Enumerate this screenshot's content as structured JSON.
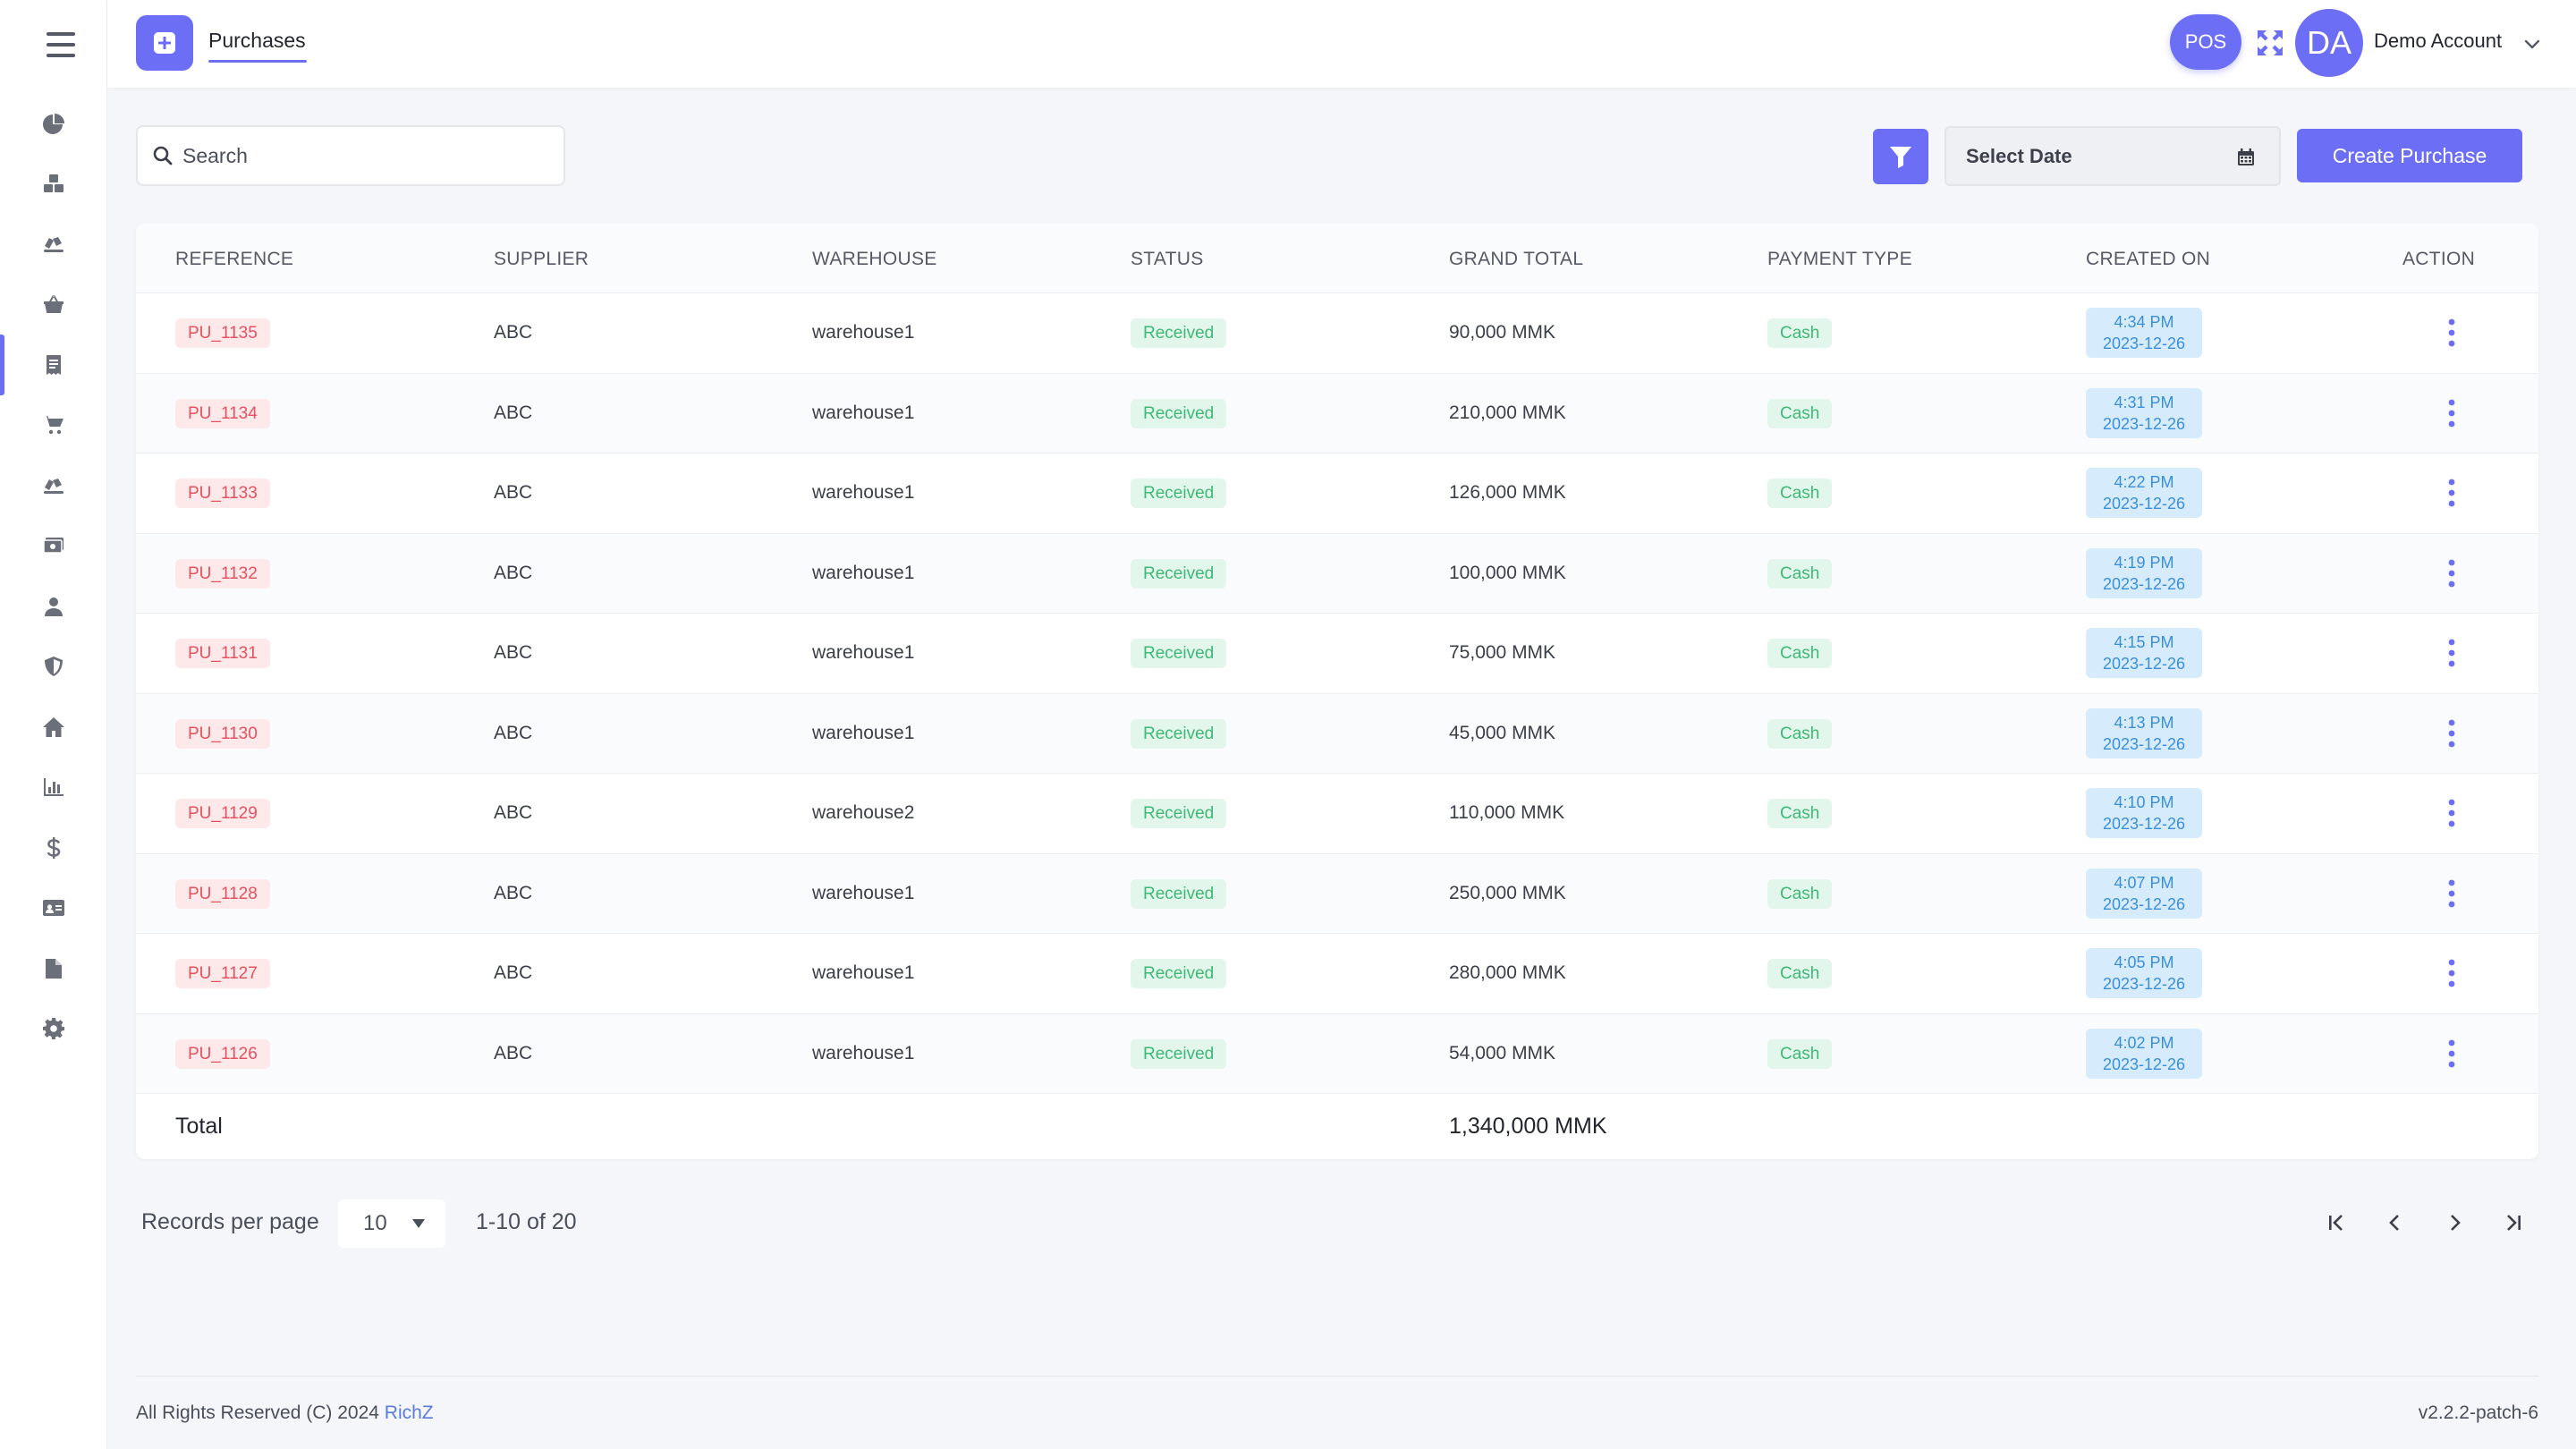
{
  "header": {
    "title": "Purchases",
    "pos_label": "POS",
    "avatar_initials": "DA",
    "account_name": "Demo Account"
  },
  "sidebar": {
    "items": [
      {
        "icon": "pie-chart-icon"
      },
      {
        "icon": "boxes-icon"
      },
      {
        "icon": "truck-loading-icon"
      },
      {
        "icon": "basket-icon"
      },
      {
        "icon": "receipt-icon",
        "active": true
      },
      {
        "icon": "cart-icon"
      },
      {
        "icon": "return-box-icon"
      },
      {
        "icon": "money-icon"
      },
      {
        "icon": "user-icon"
      },
      {
        "icon": "shield-icon"
      },
      {
        "icon": "home-icon"
      },
      {
        "icon": "bar-chart-icon"
      },
      {
        "icon": "dollar-icon"
      },
      {
        "icon": "id-card-icon"
      },
      {
        "icon": "file-icon"
      },
      {
        "icon": "gear-icon"
      }
    ]
  },
  "toolbar": {
    "search_placeholder": "Search",
    "date_placeholder": "Select Date",
    "create_label": "Create Purchase"
  },
  "table": {
    "columns": [
      "REFERENCE",
      "SUPPLIER",
      "WAREHOUSE",
      "STATUS",
      "GRAND TOTAL",
      "PAYMENT TYPE",
      "CREATED ON",
      "ACTION"
    ],
    "rows": [
      {
        "ref": "PU_1135",
        "supplier": "ABC",
        "warehouse": "warehouse1",
        "status": "Received",
        "total": "90,000 MMK",
        "payment": "Cash",
        "time": "4:34 PM",
        "date": "2023-12-26"
      },
      {
        "ref": "PU_1134",
        "supplier": "ABC",
        "warehouse": "warehouse1",
        "status": "Received",
        "total": "210,000 MMK",
        "payment": "Cash",
        "time": "4:31 PM",
        "date": "2023-12-26"
      },
      {
        "ref": "PU_1133",
        "supplier": "ABC",
        "warehouse": "warehouse1",
        "status": "Received",
        "total": "126,000 MMK",
        "payment": "Cash",
        "time": "4:22 PM",
        "date": "2023-12-26"
      },
      {
        "ref": "PU_1132",
        "supplier": "ABC",
        "warehouse": "warehouse1",
        "status": "Received",
        "total": "100,000 MMK",
        "payment": "Cash",
        "time": "4:19 PM",
        "date": "2023-12-26"
      },
      {
        "ref": "PU_1131",
        "supplier": "ABC",
        "warehouse": "warehouse1",
        "status": "Received",
        "total": "75,000 MMK",
        "payment": "Cash",
        "time": "4:15 PM",
        "date": "2023-12-26"
      },
      {
        "ref": "PU_1130",
        "supplier": "ABC",
        "warehouse": "warehouse1",
        "status": "Received",
        "total": "45,000 MMK",
        "payment": "Cash",
        "time": "4:13 PM",
        "date": "2023-12-26"
      },
      {
        "ref": "PU_1129",
        "supplier": "ABC",
        "warehouse": "warehouse2",
        "status": "Received",
        "total": "110,000 MMK",
        "payment": "Cash",
        "time": "4:10 PM",
        "date": "2023-12-26"
      },
      {
        "ref": "PU_1128",
        "supplier": "ABC",
        "warehouse": "warehouse1",
        "status": "Received",
        "total": "250,000 MMK",
        "payment": "Cash",
        "time": "4:07 PM",
        "date": "2023-12-26"
      },
      {
        "ref": "PU_1127",
        "supplier": "ABC",
        "warehouse": "warehouse1",
        "status": "Received",
        "total": "280,000 MMK",
        "payment": "Cash",
        "time": "4:05 PM",
        "date": "2023-12-26"
      },
      {
        "ref": "PU_1126",
        "supplier": "ABC",
        "warehouse": "warehouse1",
        "status": "Received",
        "total": "54,000 MMK",
        "payment": "Cash",
        "time": "4:02 PM",
        "date": "2023-12-26"
      }
    ],
    "total_label": "Total",
    "total_value": "1,340,000 MMK"
  },
  "pagination": {
    "records_label": "Records per page",
    "per_page": "10",
    "range": "1-10 of 20"
  },
  "footer": {
    "copyright": "All Rights Reserved (C) 2024 ",
    "brand": "RichZ",
    "version": "v2.2.2-patch-6"
  },
  "colors": {
    "accent": "#6c6ff5",
    "reference_badge_bg": "#fde8ea",
    "reference_badge_text": "#e2525f",
    "status_badge_bg": "#e3f6ec",
    "status_badge_text": "#3fb877",
    "date_badge_bg": "#d6ecfc",
    "date_badge_text": "#3a8fd8"
  }
}
